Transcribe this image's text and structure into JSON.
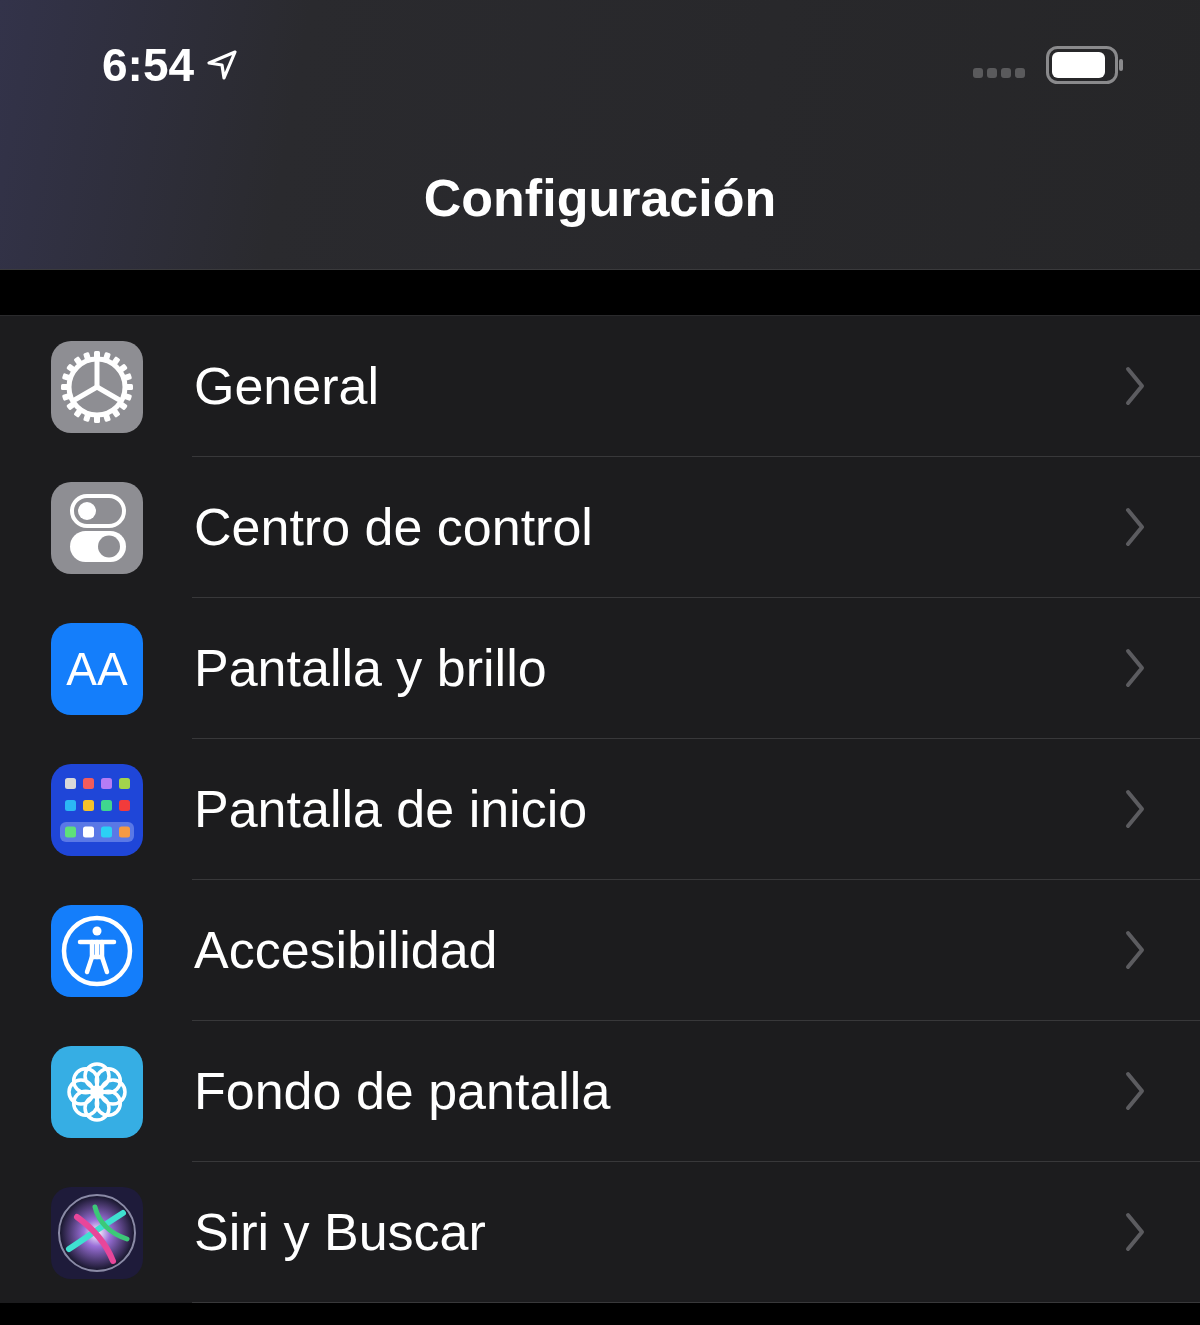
{
  "status_bar": {
    "time": "6:54",
    "location_active": true
  },
  "nav_bar": {
    "title": "Configuración"
  },
  "settings": [
    {
      "label": "General",
      "kind": "gear"
    },
    {
      "label": "Centro de control",
      "kind": "toggles"
    },
    {
      "label": "Pantalla y brillo",
      "kind": "text",
      "glyph": "AA"
    },
    {
      "label": "Pantalla de inicio",
      "kind": "grid"
    },
    {
      "label": "Accesibilidad",
      "kind": "access"
    },
    {
      "label": "Fondo de pantalla",
      "kind": "flower"
    },
    {
      "label": "Siri y Buscar",
      "kind": "siri"
    }
  ]
}
